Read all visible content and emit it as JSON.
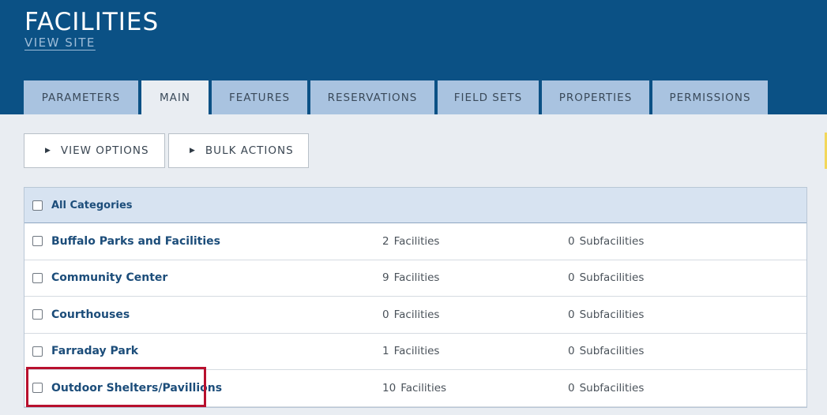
{
  "header": {
    "title": "FACILITIES",
    "view_site": "VIEW SITE"
  },
  "tabs": [
    {
      "label": "PARAMETERS",
      "active": false
    },
    {
      "label": "MAIN",
      "active": true
    },
    {
      "label": "FEATURES",
      "active": false
    },
    {
      "label": "RESERVATIONS",
      "active": false
    },
    {
      "label": "FIELD SETS",
      "active": false
    },
    {
      "label": "PROPERTIES",
      "active": false
    },
    {
      "label": "PERMISSIONS",
      "active": false
    }
  ],
  "toolbar": {
    "view_options": "VIEW OPTIONS",
    "bulk_actions": "BULK ACTIONS"
  },
  "table": {
    "header_label": "All Categories",
    "rows": [
      {
        "name": "Buffalo Parks and Facilities",
        "facilities": "2",
        "facilities_label": "Facilities",
        "subfacilities": "0",
        "subfacilities_label": "Subfacilities"
      },
      {
        "name": "Community Center",
        "facilities": "9",
        "facilities_label": "Facilities",
        "subfacilities": "0",
        "subfacilities_label": "Subfacilities"
      },
      {
        "name": "Courthouses",
        "facilities": "0",
        "facilities_label": "Facilities",
        "subfacilities": "0",
        "subfacilities_label": "Subfacilities"
      },
      {
        "name": "Farraday Park",
        "facilities": "1",
        "facilities_label": "Facilities",
        "subfacilities": "0",
        "subfacilities_label": "Subfacilities"
      },
      {
        "name": "Outdoor Shelters/Pavillions",
        "facilities": "10",
        "facilities_label": "Facilities",
        "subfacilities": "0",
        "subfacilities_label": "Subfacilities"
      }
    ]
  },
  "colors": {
    "header_bg": "#0b5185",
    "tab_bg": "#a9c3e0",
    "page_bg": "#e9edf2",
    "link_text": "#1c4d7a",
    "highlight": "#b8102e"
  }
}
